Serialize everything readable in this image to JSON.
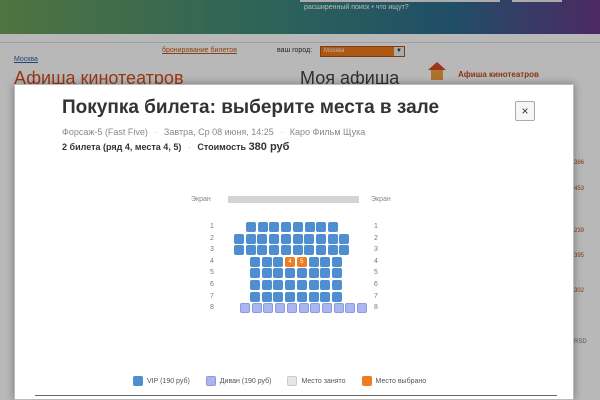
{
  "header": {
    "search_hint": "расширенный поиск • что ищут?"
  },
  "site": {
    "city_link": "Москва",
    "booking_link": "бронирование билетов",
    "city_label": "ваш город:",
    "city_value": "Москва",
    "heading": "Афиша кинотеатров",
    "heading_right": "Моя афиша",
    "side_title": "Афиша кинотеатров",
    "side_numbers": [
      "386",
      "453",
      "239",
      "395",
      "302",
      "RSD"
    ]
  },
  "modal": {
    "title": "Покупка билета: выберите места в зале",
    "close_label": "×",
    "film": "Форсаж-5 (Fast Five)",
    "datetime": "Завтра, Ср 08 июня, 14:25",
    "cinema": "Каро Фильм Щука",
    "tickets": "2 билета (ряд 4, места 4, 5)",
    "cost_label": "Стоимость",
    "cost_value": "380 руб"
  },
  "hall": {
    "screen_label": "Экран",
    "rows": [
      "1",
      "2",
      "3",
      "4",
      "5",
      "6",
      "7",
      "8"
    ],
    "selected_seats": [
      "4",
      "5"
    ]
  },
  "legend": [
    {
      "label": "VIP (190 руб)",
      "color": "#4f8fd0"
    },
    {
      "label": "Диван (190 руб)",
      "color": "#a9b6ef"
    },
    {
      "label": "Место занято",
      "color": "#e6e6e6"
    },
    {
      "label": "Место выбрано",
      "color": "#ef7d22"
    }
  ],
  "colors": {
    "vip": "#4f8fd0",
    "sofa": "#a9b6ef",
    "taken": "#e6e6e6",
    "selected": "#ef7d22",
    "accent": "#d64d1c"
  }
}
